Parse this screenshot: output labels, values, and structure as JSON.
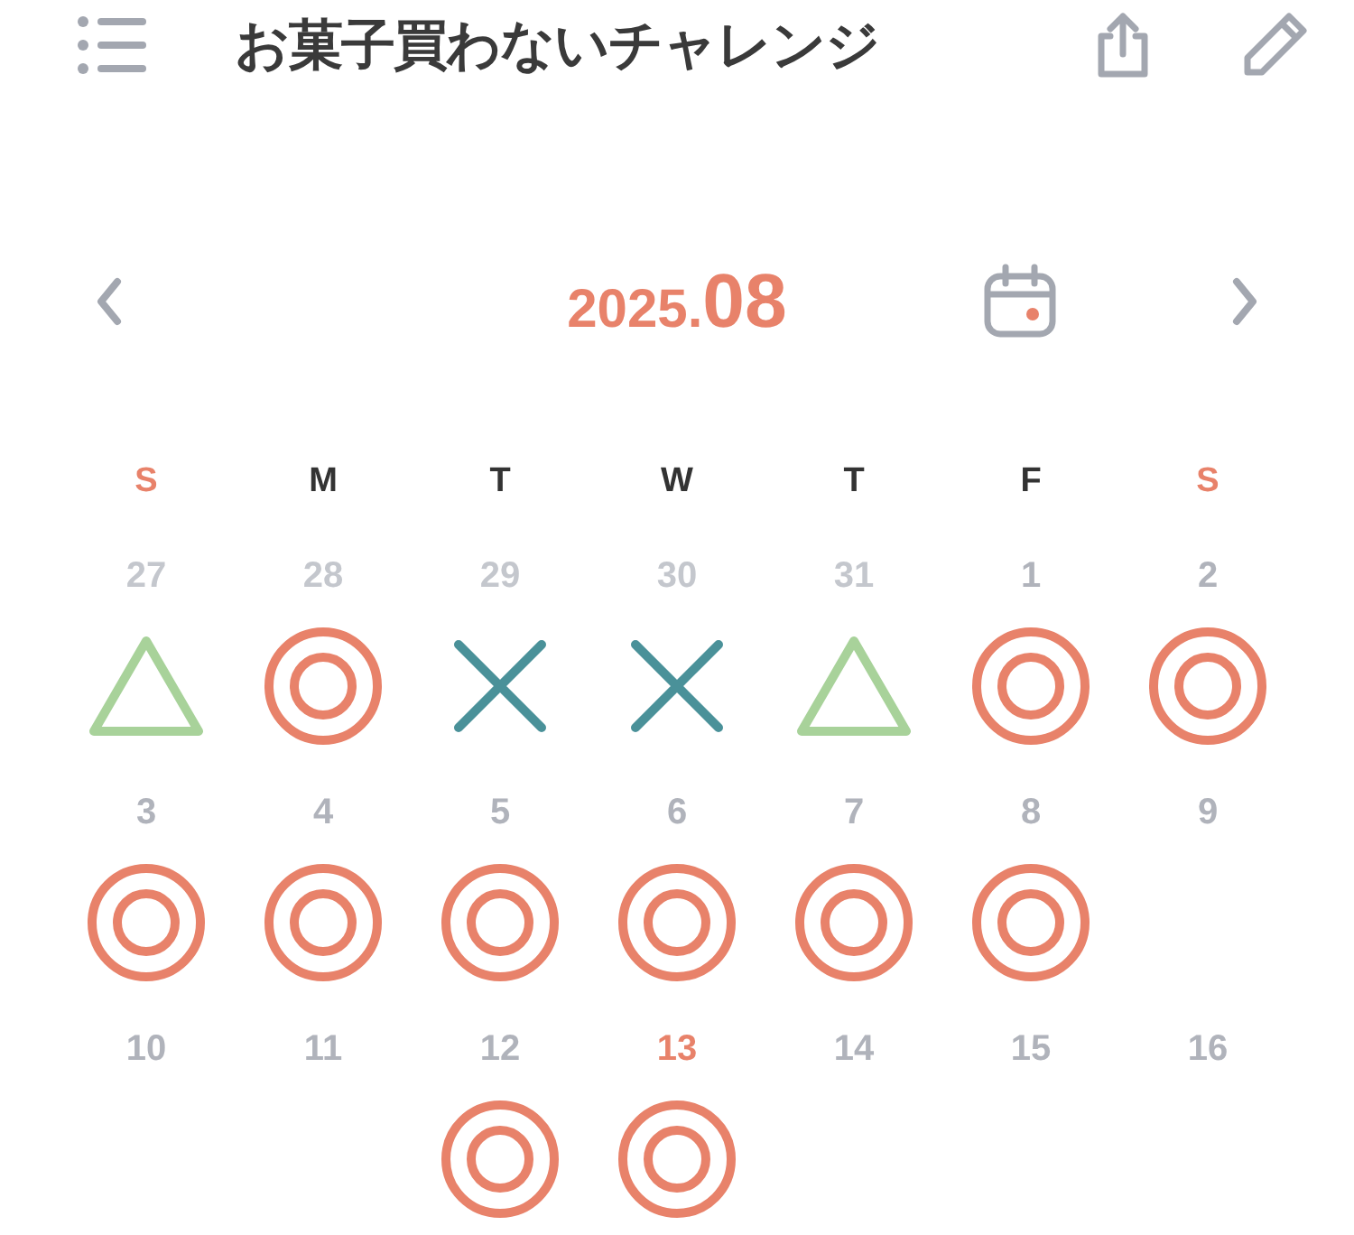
{
  "header": {
    "title": "お菓子買わないチャレンジ"
  },
  "month_nav": {
    "year": "2025.",
    "month": "08"
  },
  "weekdays": [
    {
      "label": "S",
      "weekend": true
    },
    {
      "label": "M",
      "weekend": false
    },
    {
      "label": "T",
      "weekend": false
    },
    {
      "label": "W",
      "weekend": false
    },
    {
      "label": "T",
      "weekend": false
    },
    {
      "label": "F",
      "weekend": false
    },
    {
      "label": "S",
      "weekend": true
    }
  ],
  "weeks": [
    [
      {
        "date": "27",
        "other_month": true,
        "today": false,
        "kind": "triangle"
      },
      {
        "date": "28",
        "other_month": true,
        "today": false,
        "kind": "circle"
      },
      {
        "date": "29",
        "other_month": true,
        "today": false,
        "kind": "cross"
      },
      {
        "date": "30",
        "other_month": true,
        "today": false,
        "kind": "cross"
      },
      {
        "date": "31",
        "other_month": true,
        "today": false,
        "kind": "triangle"
      },
      {
        "date": "1",
        "other_month": false,
        "today": false,
        "kind": "circle"
      },
      {
        "date": "2",
        "other_month": false,
        "today": false,
        "kind": "circle"
      }
    ],
    [
      {
        "date": "3",
        "other_month": false,
        "today": false,
        "kind": "circle"
      },
      {
        "date": "4",
        "other_month": false,
        "today": false,
        "kind": "circle"
      },
      {
        "date": "5",
        "other_month": false,
        "today": false,
        "kind": "circle"
      },
      {
        "date": "6",
        "other_month": false,
        "today": false,
        "kind": "circle"
      },
      {
        "date": "7",
        "other_month": false,
        "today": false,
        "kind": "circle"
      },
      {
        "date": "8",
        "other_month": false,
        "today": false,
        "kind": "circle"
      },
      {
        "date": "9",
        "other_month": false,
        "today": false,
        "kind": "blank"
      }
    ],
    [
      {
        "date": "10",
        "other_month": false,
        "today": false,
        "kind": "blank"
      },
      {
        "date": "11",
        "other_month": false,
        "today": false,
        "kind": "blank"
      },
      {
        "date": "12",
        "other_month": false,
        "today": false,
        "kind": "circle"
      },
      {
        "date": "13",
        "other_month": false,
        "today": true,
        "kind": "circle"
      },
      {
        "date": "14",
        "other_month": false,
        "today": false,
        "kind": "blank"
      },
      {
        "date": "15",
        "other_month": false,
        "today": false,
        "kind": "blank"
      },
      {
        "date": "16",
        "other_month": false,
        "today": false,
        "kind": "blank"
      }
    ]
  ]
}
